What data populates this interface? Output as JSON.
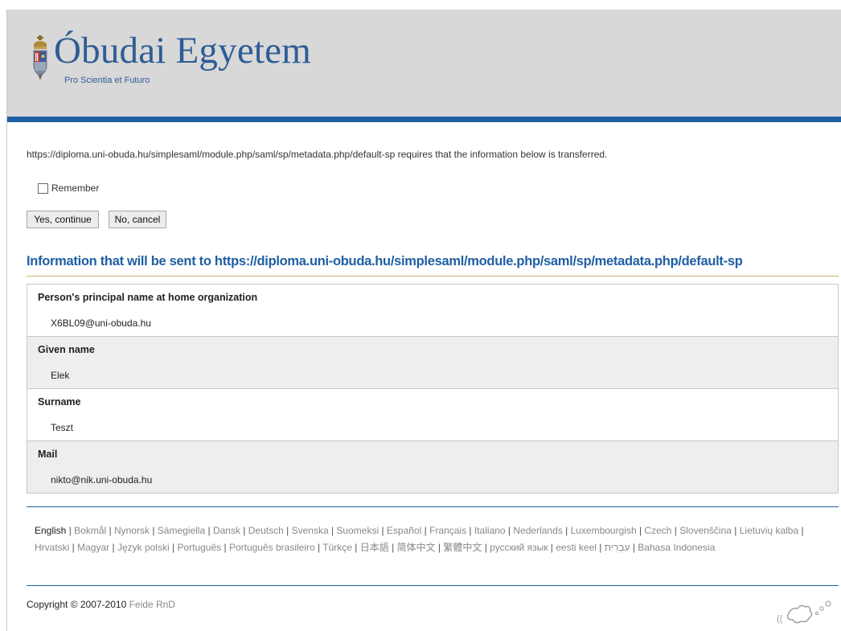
{
  "header": {
    "title": "Óbudai Egyetem",
    "tagline": "Pro Scientia et Futuro"
  },
  "consent": {
    "intro": "https://diploma.uni-obuda.hu/simplesaml/module.php/saml/sp/metadata.php/default-sp requires that the information below is transferred.",
    "remember_label": "Remember",
    "remember_checked": false,
    "yes_label": "Yes, continue",
    "no_label": "No, cancel"
  },
  "info": {
    "heading": "Information that will be sent to https://diploma.uni-obuda.hu/simplesaml/module.php/saml/sp/metadata.php/default-sp",
    "attributes": [
      {
        "name": "Person's principal name at home organization",
        "value": "X6BL09@uni-obuda.hu"
      },
      {
        "name": "Given name",
        "value": "Elek"
      },
      {
        "name": "Surname",
        "value": "Teszt"
      },
      {
        "name": "Mail",
        "value": "nikto@nik.uni-obuda.hu"
      }
    ]
  },
  "languages": {
    "current": "English",
    "items": [
      "English",
      "Bokmål",
      "Nynorsk",
      "Sámegiella",
      "Dansk",
      "Deutsch",
      "Svenska",
      "Suomeksi",
      "Español",
      "Français",
      "Italiano",
      "Nederlands",
      "Luxembourgish",
      "Czech",
      "Slovenščina",
      "Lietuvių kalba",
      "Hrvatski",
      "Magyar",
      "Język polski",
      "Português",
      "Português brasileiro",
      "Türkçe",
      "日本語",
      "简体中文",
      "繁體中文",
      "русский язык",
      "eesti keel",
      "עִבְרִית",
      "Bahasa Indonesia"
    ]
  },
  "footer": {
    "copyright_text": "Copyright © 2007-2010 ",
    "copyright_link": "Feide RnD"
  },
  "colors": {
    "brand_blue": "#1f5fa3",
    "header_bg": "#d8d8d8",
    "row_alt_bg": "#eeeeee",
    "link_gray": "#888888"
  },
  "icons": {
    "crest": "university-crest-icon",
    "feide": "feide-logo-icon"
  }
}
